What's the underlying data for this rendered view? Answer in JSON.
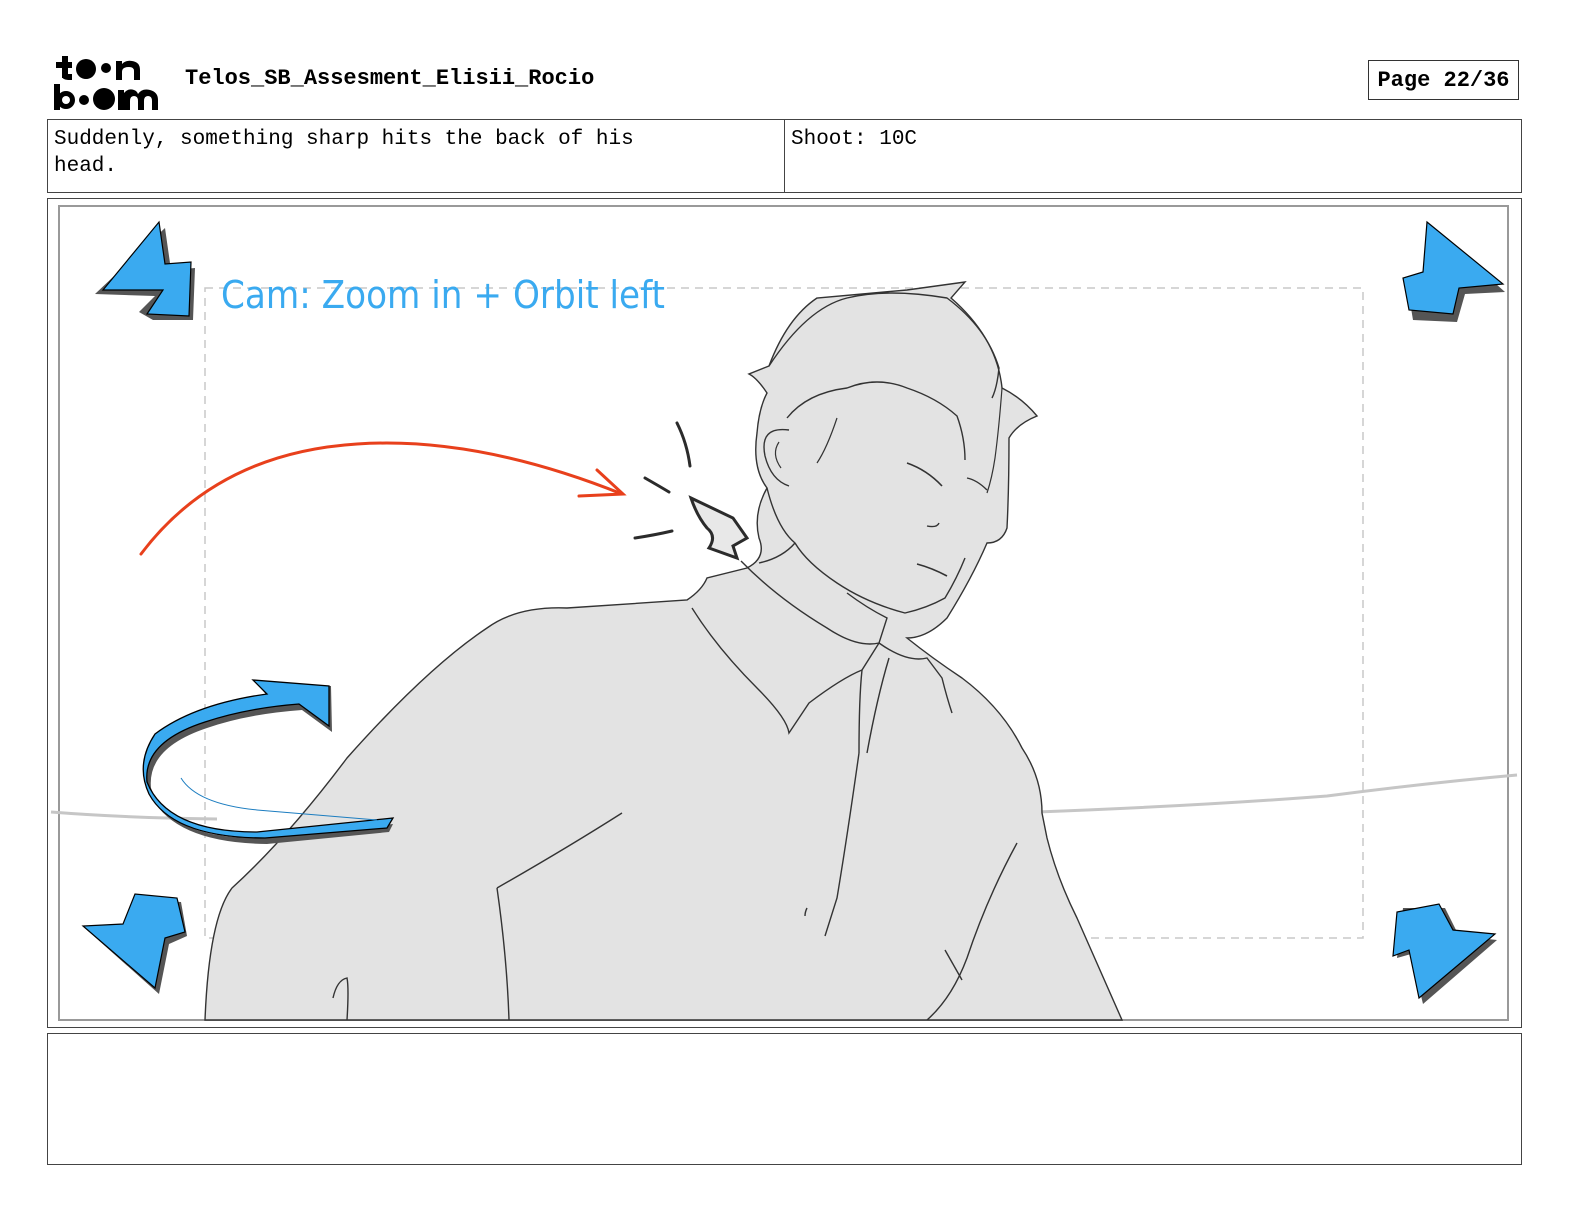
{
  "header": {
    "logo_text": "toonboom",
    "title": "Telos_SB_Assesment_Elisii_Rocio",
    "page": "Page 22/36"
  },
  "info": {
    "action_text": "Suddenly, something sharp hits the back of his head.",
    "action_line1": "Suddenly, something sharp hits the back of his",
    "action_line2": "head.",
    "shoot": "Shoot: 10C"
  },
  "panel": {
    "camera_note": "Cam: Zoom in + Orbit left",
    "arrow_color": "#3aaaf0",
    "motion_arrow_color": "#e8401c",
    "character_fill": "#e3e3e3"
  },
  "notes": {
    "text": ""
  }
}
